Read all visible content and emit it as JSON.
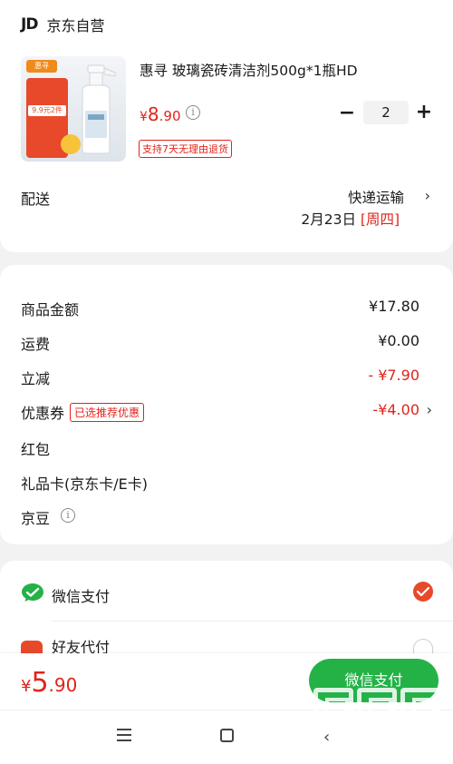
{
  "shop": {
    "logo": "JD",
    "name": "京东自营"
  },
  "product": {
    "title": "惠寻 玻璃瓷砖清洁剂500g*1瓶HD",
    "price_symbol": "¥",
    "price_int": "8",
    "price_dec": ".90",
    "quantity": "2",
    "return_policy": "支持7天无理由退货",
    "thumb_brand": "惠寻",
    "thumb_promo": "9.9元2件"
  },
  "shipping": {
    "label": "配送",
    "method": "快递运输",
    "date": "2月23日",
    "weekday": "[周四]"
  },
  "summary": {
    "rows": [
      {
        "label": "商品金额",
        "value": "¥17.80"
      },
      {
        "label": "运费",
        "value": "¥0.00"
      },
      {
        "label": "立减",
        "value": "- ¥7.90"
      },
      {
        "label": "优惠券",
        "badge": "已选推荐优惠",
        "value": "-¥4.00"
      },
      {
        "label": "红包"
      },
      {
        "label": "礼品卡(京东卡/E卡)"
      },
      {
        "label": "京豆"
      }
    ]
  },
  "payment": {
    "options": [
      {
        "label": "微信支付",
        "selected": true
      },
      {
        "label": "好友代付",
        "selected": false
      }
    ]
  },
  "footer": {
    "total_symbol": "¥",
    "total_int": "5",
    "total_dec": ".90",
    "pay_button": "微信支付"
  },
  "watermark": {
    "text": "zhizhizhi.com"
  },
  "colors": {
    "accent_red": "#e2231a",
    "wechat_green": "#24b247"
  }
}
